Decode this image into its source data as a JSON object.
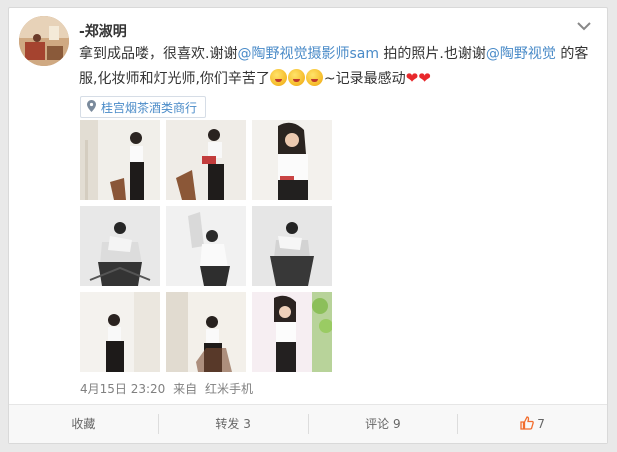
{
  "post": {
    "username": "-郑淑明",
    "text_segments": [
      {
        "text": "拿到成品喽，很喜欢.谢谢",
        "type": "plain"
      },
      {
        "text": "@陶野视觉摄影师sam",
        "type": "mention"
      },
      {
        "text": " 拍的照片.也谢谢",
        "type": "plain"
      },
      {
        "text": "@陶野视觉",
        "type": "mention"
      },
      {
        "text": " 的客服,化妆师和灯光师,你们辛苦了",
        "type": "plain"
      }
    ],
    "text_tail": "~记录最感动",
    "location": "桂宫烟茶酒类商行",
    "timestamp": "4月15日 23:20",
    "source_prefix": "来自",
    "source": "红米手机"
  },
  "actions": {
    "favorite_label": "收藏",
    "repost_label": "转发 3",
    "comment_label": "评论 9",
    "like_count": "7"
  },
  "icons": {
    "more": "chevron-down-icon",
    "location": "location-pin-icon",
    "emoji": "kiss-emoji-icon",
    "heart": "heart-icon",
    "like": "thumbs-up-icon"
  },
  "colors": {
    "mention": "#4a8bc8",
    "heart": "#e8282b",
    "like": "#f26c2c"
  },
  "photos": [
    {
      "name": "photo-1"
    },
    {
      "name": "photo-2"
    },
    {
      "name": "photo-3"
    },
    {
      "name": "photo-4"
    },
    {
      "name": "photo-5"
    },
    {
      "name": "photo-6"
    },
    {
      "name": "photo-7"
    },
    {
      "name": "photo-8"
    },
    {
      "name": "photo-9"
    }
  ]
}
